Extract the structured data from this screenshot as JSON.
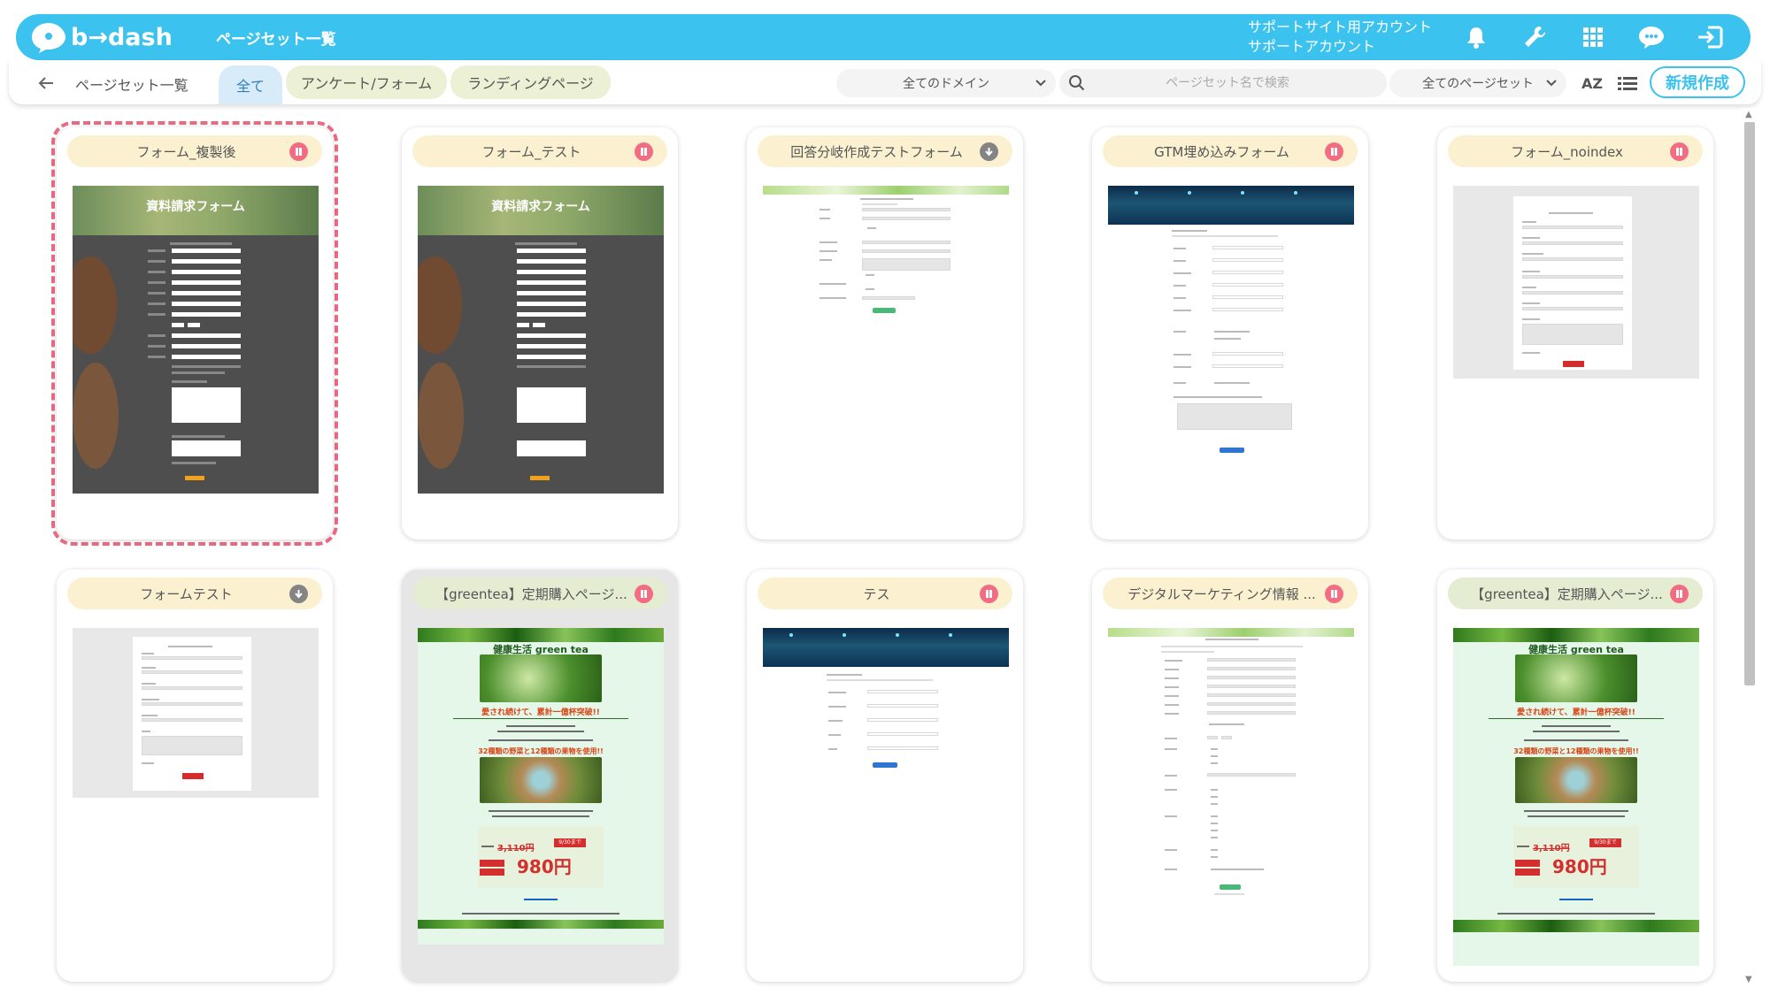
{
  "header": {
    "logo_text": "b→dash",
    "title": "ページセット一覧",
    "account_line1": "サポートサイト用アカウント",
    "account_line2": "サポートアカウント",
    "icons": [
      "bell-icon",
      "wrench-icon",
      "apps-grid-icon",
      "support-chat-icon",
      "logout-icon"
    ]
  },
  "toolbar": {
    "breadcrumb": "ページセット一覧",
    "tabs": [
      {
        "label": "全て",
        "active": true
      },
      {
        "label": "アンケート/フォーム",
        "active": false
      },
      {
        "label": "ランディングページ",
        "active": false
      }
    ],
    "domain_select": "全てのドメイン",
    "search_placeholder": "ページセット名で検索",
    "pageset_select": "全てのページセット",
    "sort_label": "AZ",
    "new_button": "新規作成"
  },
  "colors": {
    "header_bg": "#3cc2ef",
    "tab_active_bg": "#d7ecf8",
    "tab_bg": "#ecf0d4",
    "card_head_form": "#fbf1d0",
    "card_head_lp": "#e4ecd2",
    "status_paused": "#f26d81",
    "status_draft": "#848484",
    "selection_border": "#ea6a83"
  },
  "cards": [
    {
      "title": "フォーム_複製後",
      "status": "paused",
      "selected": true
    },
    {
      "title": "フォーム_テスト",
      "status": "paused",
      "selected": false
    },
    {
      "title": "回答分岐作成テストフォーム",
      "status": "draft",
      "selected": false
    },
    {
      "title": "GTM埋め込みフォーム",
      "status": "paused",
      "selected": false
    },
    {
      "title": "フォーム_noindex",
      "status": "paused",
      "selected": false
    },
    {
      "title": "フォームテスト",
      "status": "draft",
      "selected": false
    },
    {
      "title": "【greentea】定期購入ページ...",
      "status": "paused",
      "selected": false
    },
    {
      "title": "テス",
      "status": "paused",
      "selected": false
    },
    {
      "title": "デジタルマーケティング情報 ...",
      "status": "paused",
      "selected": false
    },
    {
      "title": "【greentea】定期購入ページ...",
      "status": "paused",
      "selected": false
    }
  ],
  "previews": {
    "dark_form_title": "資料請求フォーム",
    "lp_heading": "健康生活 green tea",
    "lp_catch": "愛され続けて、累計一億杯突破!!",
    "lp_sub": "32種類の野菜と12種類の果物を使用!!",
    "lp_price": "980円",
    "lp_old_price": "3,110円",
    "lp_date": "9/30まで"
  }
}
